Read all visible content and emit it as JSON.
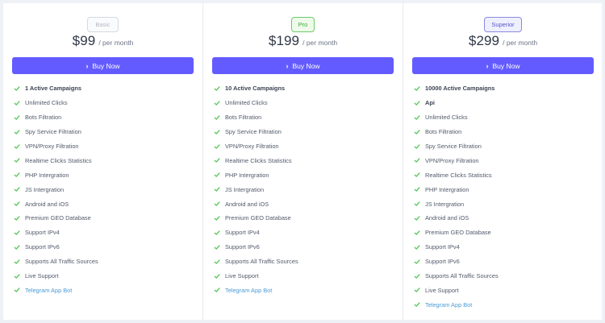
{
  "plans": [
    {
      "badge": "Basic",
      "price": "$99",
      "period": "/ per month",
      "button": "Buy Now",
      "features": [
        "1 Active Campaigns",
        "Unlimited Clicks",
        "Bots Filtration",
        "Spy Service Filtration",
        "VPN/Proxy Filtration",
        "Realtime Clicks Statistics",
        "PHP Intergration",
        "JS Intergration",
        "Android and iOS",
        "Premium GEO Database",
        "Support IPv4",
        "Support IPv6",
        "Supports All Traffic Sources",
        "Live Support",
        "Telegram App Bot"
      ]
    },
    {
      "badge": "Pro",
      "price": "$199",
      "period": "/ per month",
      "button": "Buy Now",
      "features": [
        "10 Active Campaigns",
        "Unlimited Clicks",
        "Bots Filtration",
        "Spy Service Filtration",
        "VPN/Proxy Filtration",
        "Realtime Clicks Statistics",
        "PHP Intergration",
        "JS Intergration",
        "Android and iOS",
        "Premium GEO Database",
        "Support IPv4",
        "Support IPv6",
        "Supports All Traffic Sources",
        "Live Support",
        "Telegram App Bot"
      ]
    },
    {
      "badge": "Superior",
      "price": "$299",
      "period": "/ per month",
      "button": "Buy Now",
      "features": [
        "10000 Active Campaigns",
        "Api",
        "Unlimited Clicks",
        "Bots Filtration",
        "Spy Service Filtration",
        "VPN/Proxy Filtration",
        "Realtime Clicks Statistics",
        "PHP Intergration",
        "JS Intergration",
        "Android and iOS",
        "Premium GEO Database",
        "Support IPv4",
        "Support IPv6",
        "Supports All Traffic Sources",
        "Live Support",
        "Telegram App Bot"
      ]
    }
  ],
  "icons": {
    "check": "check-icon",
    "chevron": "chevron-right-icon"
  },
  "colors": {
    "accent": "#635bff",
    "check": "#4cc24c",
    "link": "#4a9bd6",
    "pro_badge": "#3ca43c",
    "superior_badge": "#5656c8"
  }
}
